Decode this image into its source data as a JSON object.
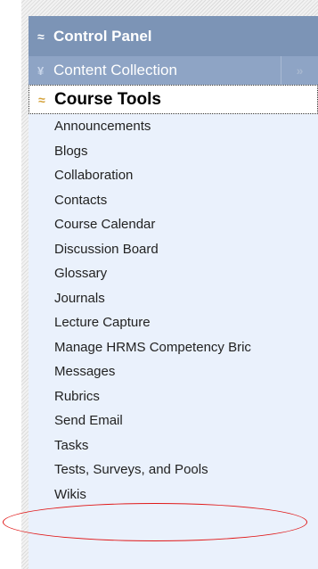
{
  "control_panel": {
    "title": "Control Panel",
    "icon": "double-chevron-up-icon"
  },
  "content_collection": {
    "title": "Content Collection",
    "icon": "double-chevron-down-icon",
    "expand_icon": "double-chevron-right-icon"
  },
  "course_tools": {
    "title": "Course Tools",
    "icon": "double-chevron-up-icon",
    "items": [
      "Announcements",
      "Blogs",
      "Collaboration",
      "Contacts",
      "Course Calendar",
      "Discussion Board",
      "Glossary",
      "Journals",
      "Lecture Capture",
      "Manage HRMS Competency Bric",
      "Messages",
      "Rubrics",
      "Send Email",
      "Tasks",
      "Tests, Surveys, and Pools",
      "Wikis"
    ]
  },
  "colors": {
    "control_panel_bg": "#7c94b6",
    "content_collection_bg": "#8ea4c5",
    "menu_bg": "#eaf1fc",
    "highlight_ellipse": "#e01818",
    "course_tools_chevron": "#d4a23a"
  }
}
